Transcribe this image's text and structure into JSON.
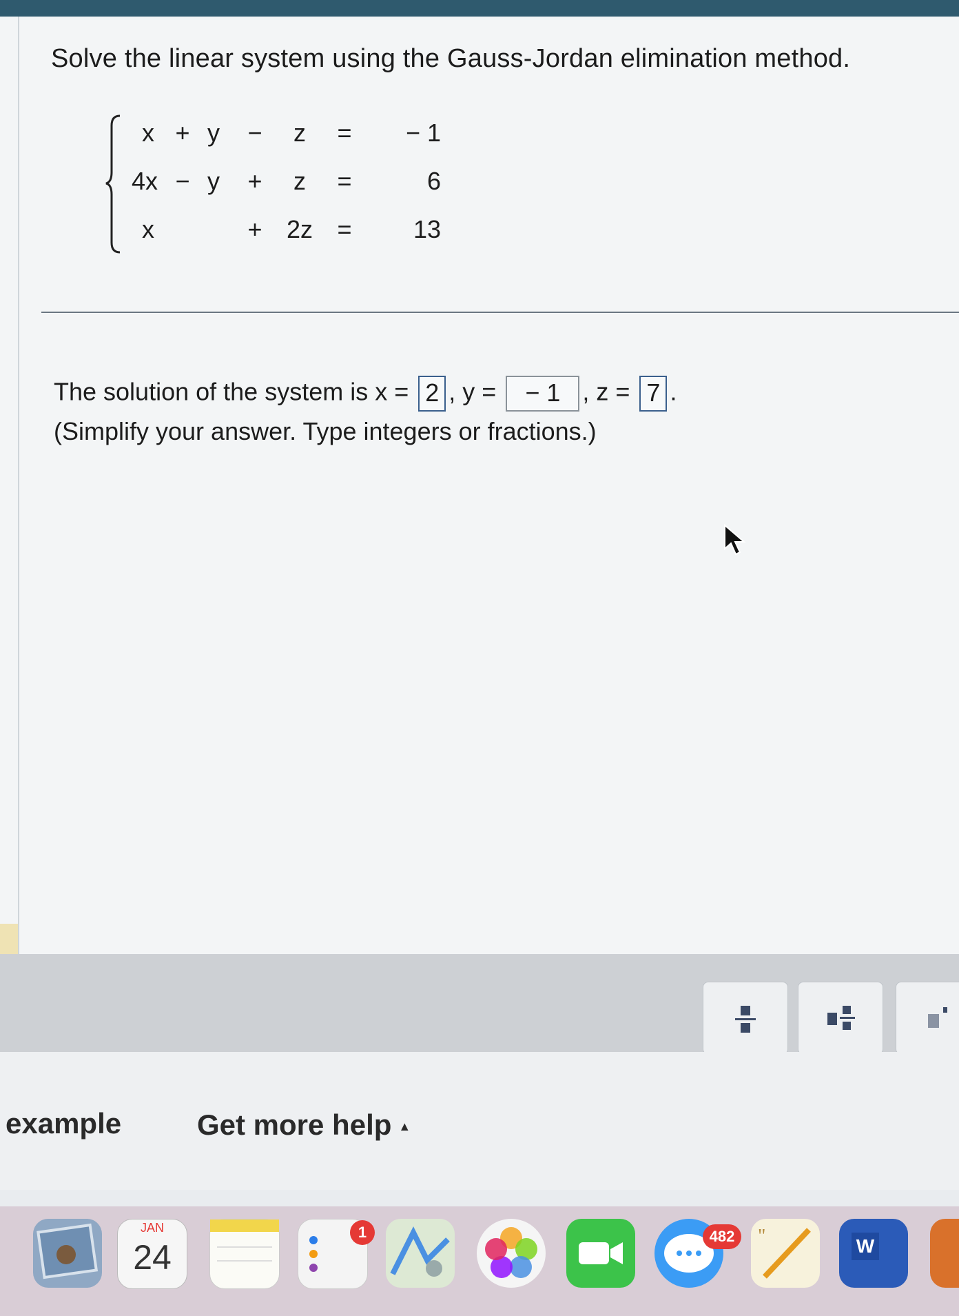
{
  "question": {
    "title": "Solve the linear system using the Gauss-Jordan elimination method.",
    "equations": [
      [
        "x",
        "+",
        "y",
        "−",
        "z",
        "=",
        "− 1"
      ],
      [
        "4x",
        "−",
        "y",
        "+",
        "z",
        "=",
        "6"
      ],
      [
        "x",
        "",
        "",
        "+",
        "2z",
        "=",
        "13"
      ]
    ]
  },
  "answer": {
    "prefix": "The solution of the system is x =",
    "x_value": "2",
    "y_label": ", y =",
    "y_value": "− 1",
    "z_label": ", z =",
    "z_value": "7",
    "suffix": ".",
    "hint": "(Simplify your answer. Type integers or fractions.)"
  },
  "help": {
    "example_label": "example",
    "more_help_label": "Get more help",
    "caret": "▲"
  },
  "dock": {
    "calendar_month": "JAN",
    "calendar_day": "24",
    "reminders_badge": "1",
    "messages_badge": "482",
    "word_letter": "W"
  },
  "colors": {
    "top_bar": "#2f5a6e",
    "answer_box_border": "#3a5f8c",
    "badge": "#e53935"
  }
}
